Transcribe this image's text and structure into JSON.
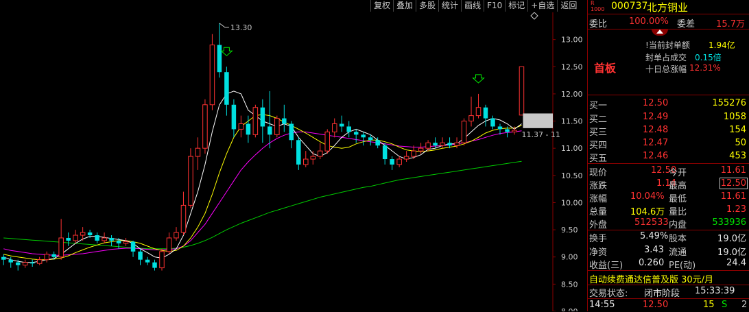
{
  "toolbar": [
    "复权",
    "叠加",
    "多股",
    "统计",
    "画线",
    "F10",
    "标记",
    "+自选",
    "返回"
  ],
  "header": {
    "r_badge_r": "R",
    "r_badge_num": "1000",
    "code": "000737",
    "name": "北方铜业"
  },
  "ratio": {
    "label": "委比",
    "value": "100.00%",
    "diff_label": "委差",
    "diff_value": "15.7万"
  },
  "seal": {
    "amount_label": "当前封单额",
    "amount_value": "1.94亿",
    "deal_label": "封单占成交",
    "deal_value": "0.15倍",
    "ten_label": "十日总涨幅",
    "ten_value": "12.31%",
    "tag": "首板"
  },
  "bids": [
    {
      "label": "买一",
      "price": "12.50",
      "vol": "155276"
    },
    {
      "label": "买二",
      "price": "12.49",
      "vol": "1058"
    },
    {
      "label": "买三",
      "price": "12.48",
      "vol": "154"
    },
    {
      "label": "买四",
      "price": "12.47",
      "vol": "50"
    },
    {
      "label": "买五",
      "price": "12.46",
      "vol": "453"
    }
  ],
  "quote": {
    "now_label": "现价",
    "now": "12.50",
    "open_label": "今开",
    "open": "11.61",
    "chg_label": "涨跌",
    "chg": "1.14",
    "high_label": "最高",
    "high": "12.50",
    "pct_label": "涨幅",
    "pct": "10.04%",
    "low_label": "最低",
    "low": "11.61",
    "vol_label": "总量",
    "vol": "104.6万",
    "vr_label": "量比",
    "vr": "1.23",
    "out_label": "外盘",
    "out": "512533",
    "in_label": "内盘",
    "in": "533936",
    "turn_label": "换手",
    "turn": "5.49%",
    "cap_label": "股本",
    "cap": "19.0亿",
    "nav_label": "净资",
    "nav": "3.43",
    "float_label": "流通",
    "float": "19.0亿",
    "eps_label": "收益(三)",
    "eps": "0.260",
    "pe_label": "PE(动)",
    "pe": "24.4"
  },
  "promo": "自动续费通达信普及版  30元/月",
  "status": {
    "label": "交易状态:",
    "value": "闭市阶段",
    "time": "15:33:39"
  },
  "tick": {
    "time": "14:55",
    "price": "12.50",
    "vol": "15",
    "side": "S",
    "count": "2"
  },
  "chart_data": {
    "type": "candlestick",
    "ylim": [
      8.0,
      13.5
    ],
    "y_ticks": [
      "13.00",
      "12.50",
      "12.00",
      "11.50",
      "11.00",
      "10.50",
      "10.00",
      "9.50",
      "9.00",
      "8.50",
      "8.00"
    ],
    "max_label": "13.30",
    "range_label": "11.37 - 11",
    "colors": {
      "up": "#ff3232",
      "down": "#00e0e0",
      "ma5": "#ffffff",
      "ma10": "#ffff00",
      "ma20": "#ff00ff",
      "ma60": "#00cc00"
    },
    "candles": [
      [
        9.0,
        8.95,
        9.05,
        8.85
      ],
      [
        8.95,
        8.9,
        9.0,
        8.8
      ],
      [
        8.9,
        8.85,
        8.95,
        8.75
      ],
      [
        8.85,
        8.9,
        8.95,
        8.8
      ],
      [
        8.9,
        8.88,
        8.95,
        8.82
      ],
      [
        8.88,
        8.95,
        9.0,
        8.85
      ],
      [
        8.95,
        9.05,
        9.1,
        8.9
      ],
      [
        9.05,
        9.0,
        9.1,
        8.95
      ],
      [
        9.0,
        9.35,
        9.7,
        8.95
      ],
      [
        9.35,
        9.3,
        9.45,
        9.2
      ],
      [
        9.3,
        9.4,
        9.5,
        9.25
      ],
      [
        9.4,
        9.45,
        9.55,
        9.3
      ],
      [
        9.45,
        9.4,
        9.5,
        9.35
      ],
      [
        9.4,
        9.3,
        9.45,
        9.25
      ],
      [
        9.3,
        9.35,
        9.45,
        9.25
      ],
      [
        9.35,
        9.3,
        9.4,
        9.2
      ],
      [
        9.3,
        9.25,
        9.35,
        9.15
      ],
      [
        9.25,
        9.28,
        9.35,
        9.2
      ],
      [
        9.28,
        9.1,
        9.3,
        9.0
      ],
      [
        9.1,
        8.95,
        9.15,
        8.85
      ],
      [
        8.95,
        8.9,
        9.0,
        8.85
      ],
      [
        8.9,
        8.8,
        8.95,
        8.75
      ],
      [
        8.8,
        9.1,
        9.15,
        8.75
      ],
      [
        9.1,
        9.35,
        9.45,
        9.05
      ],
      [
        9.35,
        9.45,
        9.55,
        9.3
      ],
      [
        9.45,
        9.95,
        10.2,
        9.4
      ],
      [
        9.95,
        10.85,
        11.0,
        9.9
      ],
      [
        10.85,
        11.0,
        11.2,
        10.6
      ],
      [
        11.0,
        11.8,
        11.9,
        10.9
      ],
      [
        11.8,
        12.9,
        13.1,
        11.7
      ],
      [
        12.9,
        12.4,
        13.3,
        12.3
      ],
      [
        12.4,
        11.8,
        12.5,
        11.6
      ],
      [
        11.8,
        11.35,
        11.9,
        11.2
      ],
      [
        11.35,
        11.45,
        11.6,
        11.2
      ],
      [
        11.45,
        11.25,
        11.6,
        11.1
      ],
      [
        11.25,
        11.75,
        11.8,
        11.2
      ],
      [
        11.75,
        11.4,
        11.9,
        11.1
      ],
      [
        11.4,
        11.25,
        12.05,
        11.0
      ],
      [
        11.25,
        11.55,
        11.6,
        11.2
      ],
      [
        11.55,
        11.45,
        11.8,
        11.3
      ],
      [
        11.45,
        11.15,
        11.5,
        11.0
      ],
      [
        11.15,
        10.7,
        11.2,
        10.6
      ],
      [
        10.7,
        10.8,
        10.95,
        10.65
      ],
      [
        10.8,
        10.85,
        10.95,
        10.7
      ],
      [
        10.85,
        10.95,
        11.1,
        10.8
      ],
      [
        10.95,
        11.3,
        11.35,
        10.9
      ],
      [
        11.3,
        11.45,
        11.55,
        11.2
      ],
      [
        11.45,
        11.4,
        11.6,
        11.3
      ],
      [
        11.4,
        11.3,
        11.5,
        11.2
      ],
      [
        11.3,
        11.25,
        11.35,
        11.1
      ],
      [
        11.25,
        11.2,
        11.3,
        11.05
      ],
      [
        11.2,
        11.15,
        11.25,
        11.05
      ],
      [
        11.15,
        11.05,
        11.2,
        11.0
      ],
      [
        11.05,
        10.8,
        11.1,
        10.7
      ],
      [
        10.8,
        10.7,
        10.85,
        10.6
      ],
      [
        10.7,
        10.8,
        10.85,
        10.65
      ],
      [
        10.8,
        10.85,
        10.95,
        10.75
      ],
      [
        10.85,
        10.95,
        11.05,
        10.8
      ],
      [
        10.95,
        11.0,
        11.1,
        10.9
      ],
      [
        11.0,
        11.1,
        11.15,
        10.95
      ],
      [
        11.1,
        11.05,
        11.2,
        11.0
      ],
      [
        11.05,
        11.1,
        11.2,
        11.0
      ],
      [
        11.1,
        11.05,
        11.2,
        11.0
      ],
      [
        11.05,
        11.1,
        11.2,
        11.0
      ],
      [
        11.1,
        11.5,
        11.55,
        11.05
      ],
      [
        11.5,
        11.6,
        11.95,
        11.4
      ],
      [
        11.6,
        11.75,
        12.0,
        11.55
      ],
      [
        11.75,
        11.55,
        11.8,
        11.4
      ],
      [
        11.55,
        11.4,
        11.6,
        11.35
      ],
      [
        11.4,
        11.35,
        11.45,
        11.25
      ],
      [
        11.35,
        11.3,
        11.4,
        11.2
      ],
      [
        11.3,
        11.33,
        11.4,
        11.25
      ],
      [
        11.61,
        12.5,
        12.5,
        11.61
      ]
    ],
    "ma5": [
      9.0,
      8.95,
      8.92,
      8.9,
      8.9,
      8.92,
      8.95,
      8.97,
      9.05,
      9.15,
      9.25,
      9.33,
      9.38,
      9.38,
      9.36,
      9.34,
      9.32,
      9.3,
      9.25,
      9.15,
      9.08,
      9.0,
      8.98,
      9.05,
      9.15,
      9.4,
      9.8,
      10.2,
      10.7,
      11.3,
      11.8,
      12.0,
      12.05,
      12.0,
      11.7,
      11.6,
      11.5,
      11.45,
      11.4,
      11.45,
      11.4,
      11.2,
      11.05,
      10.9,
      10.85,
      10.92,
      11.05,
      11.2,
      11.3,
      11.35,
      11.3,
      11.25,
      11.15,
      11.05,
      10.95,
      10.85,
      10.8,
      10.83,
      10.88,
      10.98,
      11.0,
      11.05,
      11.08,
      11.08,
      11.18,
      11.3,
      11.42,
      11.5,
      11.55,
      11.52,
      11.45,
      11.35,
      11.45
    ],
    "ma10": [
      9.05,
      9.02,
      9.0,
      8.98,
      8.96,
      8.95,
      8.95,
      8.96,
      8.98,
      9.02,
      9.08,
      9.13,
      9.18,
      9.22,
      9.26,
      9.28,
      9.3,
      9.3,
      9.28,
      9.25,
      9.2,
      9.15,
      9.12,
      9.1,
      9.12,
      9.2,
      9.35,
      9.55,
      9.8,
      10.15,
      10.55,
      10.9,
      11.2,
      11.4,
      11.5,
      11.6,
      11.62,
      11.6,
      11.55,
      11.48,
      11.42,
      11.35,
      11.28,
      11.2,
      11.12,
      11.05,
      11.02,
      11.0,
      11.02,
      11.08,
      11.12,
      11.15,
      11.15,
      11.12,
      11.08,
      11.02,
      10.97,
      10.95,
      10.94,
      10.95,
      10.97,
      11.0,
      11.02,
      11.04,
      11.08,
      11.13,
      11.2,
      11.28,
      11.33,
      11.36,
      11.37,
      11.37,
      11.42
    ],
    "ma20": [
      9.15,
      9.12,
      9.1,
      9.08,
      9.06,
      9.05,
      9.04,
      9.03,
      9.03,
      9.04,
      9.05,
      9.06,
      9.08,
      9.1,
      9.12,
      9.14,
      9.15,
      9.16,
      9.16,
      9.15,
      9.14,
      9.13,
      9.13,
      9.14,
      9.15,
      9.2,
      9.3,
      9.45,
      9.6,
      9.8,
      10.0,
      10.2,
      10.4,
      10.6,
      10.75,
      10.88,
      11.0,
      11.1,
      11.18,
      11.24,
      11.28,
      11.3,
      11.3,
      11.28,
      11.26,
      11.24,
      11.22,
      11.2,
      11.18,
      11.16,
      11.14,
      11.12,
      11.1,
      11.08,
      11.06,
      11.04,
      11.03,
      11.02,
      11.02,
      11.03,
      11.04,
      11.05,
      11.06,
      11.08,
      11.1,
      11.13,
      11.16,
      11.2,
      11.24,
      11.27,
      11.29,
      11.3,
      11.32
    ],
    "ma60": [
      9.35,
      9.34,
      9.33,
      9.32,
      9.31,
      9.3,
      9.29,
      9.28,
      9.27,
      9.26,
      9.25,
      9.24,
      9.23,
      9.22,
      9.21,
      9.2,
      9.19,
      9.18,
      9.17,
      9.16,
      9.15,
      9.15,
      9.15,
      9.15,
      9.16,
      9.18,
      9.21,
      9.25,
      9.3,
      9.36,
      9.43,
      9.5,
      9.56,
      9.62,
      9.67,
      9.72,
      9.77,
      9.82,
      9.86,
      9.9,
      9.94,
      9.98,
      10.02,
      10.06,
      10.1,
      10.13,
      10.16,
      10.19,
      10.22,
      10.25,
      10.28,
      10.3,
      10.33,
      10.36,
      10.39,
      10.42,
      10.44,
      10.46,
      10.48,
      10.5,
      10.52,
      10.54,
      10.56,
      10.58,
      10.6,
      10.62,
      10.64,
      10.66,
      10.68,
      10.7,
      10.72,
      10.74,
      10.76
    ]
  }
}
